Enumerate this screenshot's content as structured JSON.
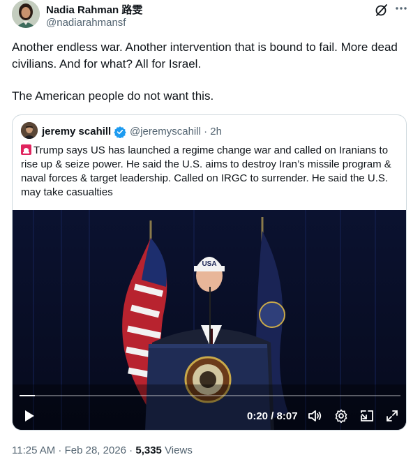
{
  "tweet": {
    "author_name": "Nadia Rahman 路雯",
    "author_handle": "@nadiarahmansf",
    "text_para1": "Another endless war. Another intervention that is bound to fail. More dead civilians. And for what? All for Israel.",
    "text_para2": "The American people do not want this.",
    "time": "11:25 AM",
    "sep": " · ",
    "date": "Feb 28, 2026",
    "views_count": "5,335",
    "views_label": " Views"
  },
  "quote": {
    "author_name": "jeremy scahill",
    "author_handle": "@jeremyscahill · 2h",
    "text": "Trump says US has launched a regime change war and called on Iranians to rise up & seize power. He said the U.S. aims to destroy Iran’s missile program & naval forces & target leadership. Called on IRGC to surrender. He said the U.S. may take casualties"
  },
  "video": {
    "time_display": "0:20 / 8:07",
    "progress": 0.041,
    "cap_text": "USA"
  },
  "icons": {
    "grok": "grok-icon",
    "more": "more-icon",
    "verified": "verified-badge-icon",
    "siren": "rotating-light-icon",
    "play": "play-icon",
    "volume": "volume-icon",
    "settings": "gear-icon",
    "pip": "picture-in-picture-icon",
    "fullscreen": "fullscreen-icon"
  },
  "colors": {
    "verified_blue": "#1d9bf0",
    "secondary_text": "#536471"
  }
}
